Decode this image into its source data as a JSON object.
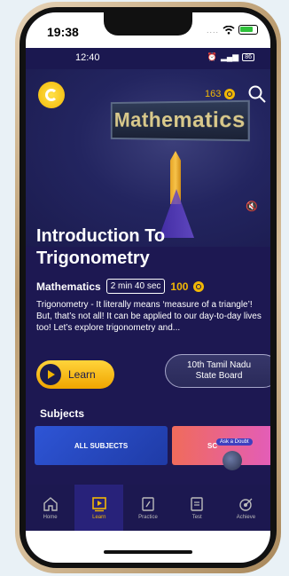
{
  "ios_status": {
    "time": "19:38",
    "dots": "...."
  },
  "app_status": {
    "time": "12:40",
    "battery": "86"
  },
  "header": {
    "coins": "163",
    "logo": "swirl-logo-icon"
  },
  "hero": {
    "board_title": "Mathematics"
  },
  "lesson": {
    "title": "Introduction To Trigonometry",
    "subject": "Mathematics",
    "duration": "2 min 40 sec",
    "points": "100",
    "description": "Trigonometry - It literally means ‘measure of a triangle’! But, that’s not all! It can be applied to our day-to-day lives too! Let’s explore trigonometry and..."
  },
  "actions": {
    "learn_label": "Learn",
    "board_label": "10th Tamil Nadu\nState Board"
  },
  "subjects": {
    "title": "Subjects",
    "cards": [
      {
        "label": "ALL SUBJECTS"
      },
      {
        "label": "SC"
      }
    ]
  },
  "doubt": {
    "label": "Ask a Doubt"
  },
  "nav": {
    "items": [
      {
        "label": "Home",
        "icon": "home-icon"
      },
      {
        "label": "Learn",
        "icon": "learn-icon",
        "active": true
      },
      {
        "label": "Practice",
        "icon": "practice-icon"
      },
      {
        "label": "Test",
        "icon": "test-icon"
      },
      {
        "label": "Achieve",
        "icon": "achieve-icon"
      }
    ]
  },
  "colors": {
    "accent": "#f2b705",
    "background": "#1d1852",
    "primary_card": "#2e55d6"
  }
}
